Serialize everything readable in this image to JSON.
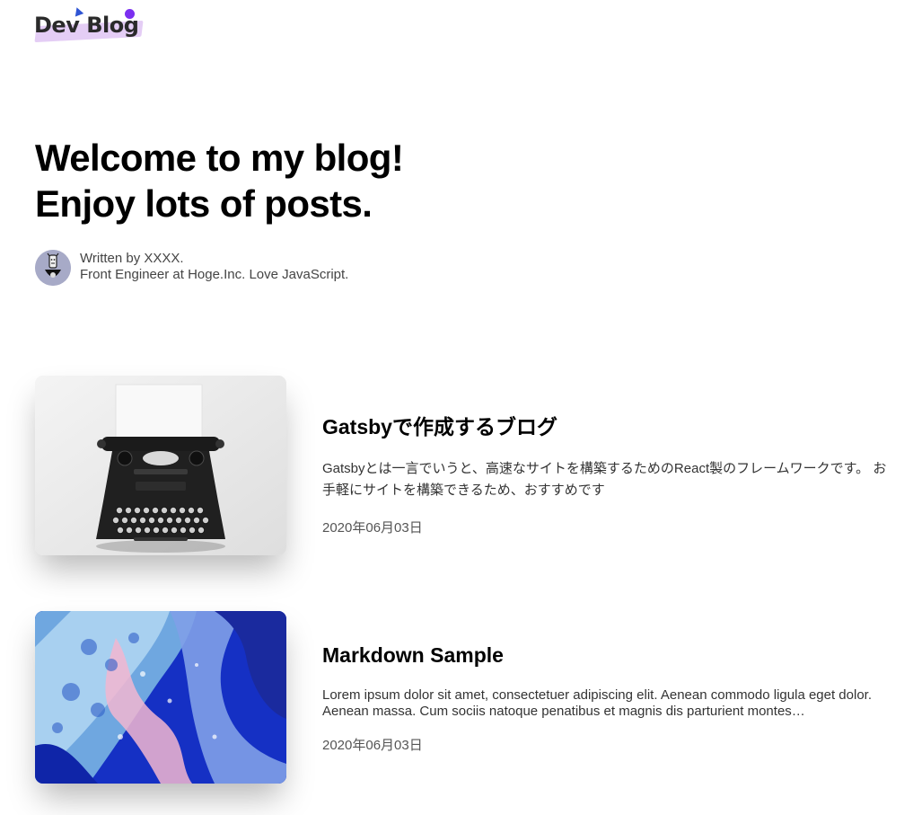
{
  "site": {
    "logo_text": "Dev Blog",
    "colors": {
      "highlight": "#e4cdf5",
      "triangle": "#2f55d4",
      "dot": "#7b2ff0"
    }
  },
  "hero": {
    "line1": "Welcome to my blog!",
    "line2": "Enjoy lots of posts."
  },
  "author": {
    "avatar_icon": "robot-avatar-icon",
    "written_by": "Written by XXXX.",
    "bio": "Front Engineer at Hoge.Inc. Love JavaScript."
  },
  "posts": [
    {
      "title": "Gatsbyで作成するブログ",
      "excerpt": "Gatsbyとは一言でいうと、高速なサイトを構築するためのReact製のフレームワークです。 お手軽にサイトを構築できるため、おすすめです",
      "date": "2020年06月03日",
      "image_icon": "typewriter-image"
    },
    {
      "title": "Markdown Sample",
      "excerpt": "Lorem ipsum dolor sit amet, consectetuer adipiscing elit. Aenean commodo ligula eget dolor. Aenean massa. Cum sociis natoque penatibus et magnis dis parturient montes…",
      "date": "2020年06月03日",
      "image_icon": "abstract-fluid-art-image"
    }
  ]
}
